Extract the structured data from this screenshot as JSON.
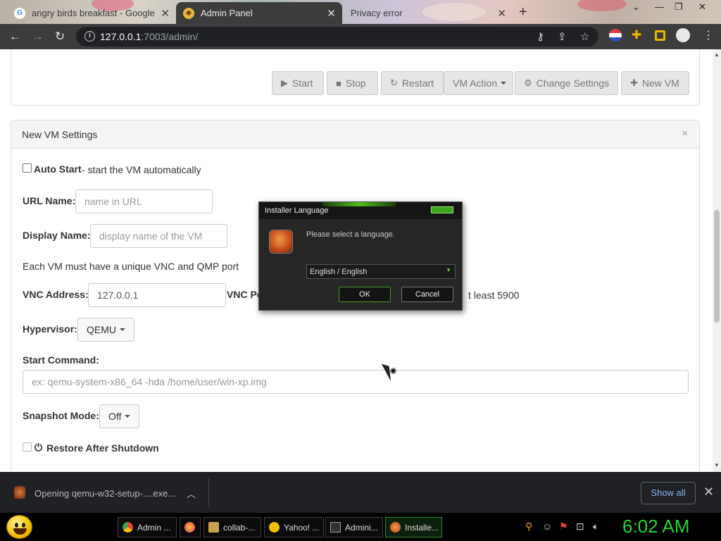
{
  "browser": {
    "tabs": [
      {
        "label": "angry birds breakfast - Google",
        "active": false
      },
      {
        "label": "Admin Panel",
        "active": true
      },
      {
        "label": "Privacy error",
        "active": false
      }
    ],
    "new_tab": "+",
    "window_controls": {
      "minimize": "—",
      "restore": "❐",
      "close": "✕"
    },
    "nav": {
      "back": "←",
      "forward": "→",
      "reload": "↻"
    },
    "url_host": "127.0.0.1",
    "url_rest": ":7003/admin/"
  },
  "toolbar": {
    "start": "Start",
    "stop": "Stop",
    "restart": "Restart",
    "vm_action": "VM Action",
    "change_settings": "Change Settings",
    "new_vm": "New VM"
  },
  "settings": {
    "title": "New VM Settings",
    "close": "×",
    "auto_start_label": "Auto Start",
    "auto_start_desc": "- start the VM automatically",
    "url_name_label": "URL Name:",
    "url_name_placeholder": "name in URL",
    "display_name_label": "Display Name:",
    "display_name_placeholder": "display name of the VM",
    "ports_note": "Each VM must have a unique VNC and QMP port",
    "vnc_address_label": "VNC Address:",
    "vnc_address_value": "127.0.0.1",
    "vnc_port_label": "VNC Po",
    "vnc_port_note": "t least 5900",
    "hypervisor_label": "Hypervisor:",
    "hypervisor_value": "QEMU",
    "start_command_label": "Start Command:",
    "start_command_placeholder": "ex: qemu-system-x86_64 -hda /home/user/win-xp.img",
    "snapshot_label": "Snapshot Mode:",
    "snapshot_value": "Off",
    "restore_label": "Restore After Shutdown"
  },
  "dialog": {
    "title": "Installer Language",
    "prompt": "Please select a language.",
    "language": "English / English",
    "ok": "OK",
    "cancel": "Cancel"
  },
  "downloads": {
    "file": "Opening qemu-w32-setup-....exe...",
    "show_all": "Show all",
    "close": "✕"
  },
  "taskbar": {
    "items": [
      {
        "label": "Admin ...",
        "color": "#4285f4"
      },
      {
        "label": "",
        "color": "#ff7139"
      },
      {
        "label": "collab-...",
        "color": "#caa24c"
      },
      {
        "label": "Yahoo! ...",
        "color": "#f0c000"
      },
      {
        "label": "Admini...",
        "color": "#888888"
      },
      {
        "label": "Installe...",
        "color": "#d0602a"
      }
    ],
    "clock": "6:02 AM"
  },
  "colors": {
    "accent_green": "#25d62b",
    "link_blue": "#8ab4f8"
  }
}
